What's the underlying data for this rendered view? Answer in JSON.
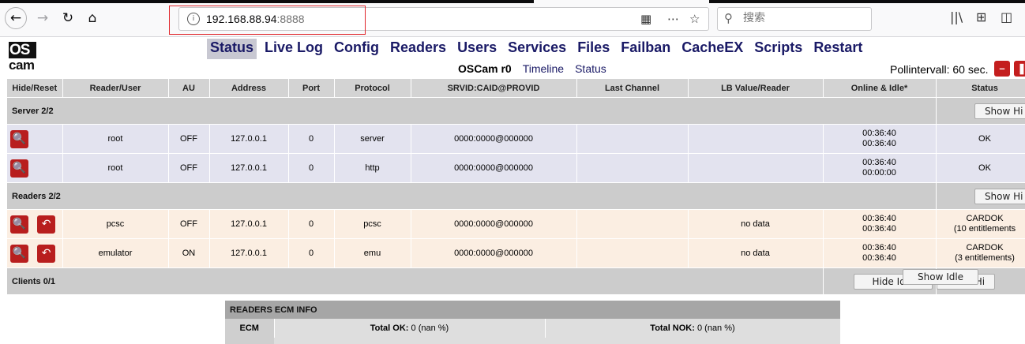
{
  "browser": {
    "url_host": "192.168.88.94",
    "url_port": ":8888",
    "search_placeholder": "搜索"
  },
  "logo": {
    "top": "OS",
    "bottom": "cam"
  },
  "menu": {
    "items": [
      "Status",
      "Live Log",
      "Config",
      "Readers",
      "Users",
      "Services",
      "Files",
      "Failban",
      "CacheEX",
      "Scripts",
      "Restart"
    ],
    "active": "Status"
  },
  "submenu": {
    "version": "OSCam r0",
    "timeline": "Timeline",
    "status": "Status"
  },
  "poll": {
    "label": "Pollintervall: 60 sec."
  },
  "table": {
    "headers": [
      "Hide/Reset",
      "Reader/User",
      "AU",
      "Address",
      "Port",
      "Protocol",
      "SRVID:CAID@PROVID",
      "Last Channel",
      "LB Value/Reader",
      "Online & Idle*",
      "Status"
    ],
    "server_group": {
      "label": "Server 2/2",
      "button": "Show Hi"
    },
    "servers": [
      {
        "name": "root",
        "au": "OFF",
        "address": "127.0.0.1",
        "port": "0",
        "protocol": "server",
        "srvid": "0000:0000@000000",
        "last_channel": "",
        "lb": "",
        "online": "00:36:40",
        "idle": "00:36:40",
        "status": "OK"
      },
      {
        "name": "root",
        "au": "OFF",
        "address": "127.0.0.1",
        "port": "0",
        "protocol": "http",
        "srvid": "0000:0000@000000",
        "last_channel": "",
        "lb": "",
        "online": "00:36:40",
        "idle": "00:00:00",
        "status": "OK"
      }
    ],
    "reader_group": {
      "label": "Readers 2/2",
      "button": "Show Hi"
    },
    "readers": [
      {
        "name": "pcsc",
        "au": "OFF",
        "address": "127.0.0.1",
        "port": "0",
        "protocol": "pcsc",
        "srvid": "0000:0000@000000",
        "last_channel": "",
        "lb": "no data",
        "online": "00:36:40",
        "idle": "00:36:40",
        "status": "CARDOK",
        "status2": "(10 entitlements"
      },
      {
        "name": "emulator",
        "au": "ON",
        "address": "127.0.0.1",
        "port": "0",
        "protocol": "emu",
        "srvid": "0000:0000@000000",
        "last_channel": "",
        "lb": "no data",
        "online": "00:36:40",
        "idle": "00:36:40",
        "status": "CARDOK",
        "status2": "(3 entitlements)"
      }
    ],
    "client_group": {
      "label": "Clients 0/1",
      "hide_idle": "Hide Idle",
      "show_idle": "Show Idle",
      "show_hidden": "Show Hi"
    }
  },
  "ecm": {
    "title": "READERS ECM INFO",
    "label": "ECM",
    "ok_label": "Total OK:",
    "ok_value": "0 (nan %)",
    "nok_label": "Total NOK:",
    "nok_value": "0 (nan %)"
  },
  "colors": {
    "accent_red": "#b81e1e",
    "server_row": "#e3e3ef",
    "reader_row": "#fbeee2"
  }
}
